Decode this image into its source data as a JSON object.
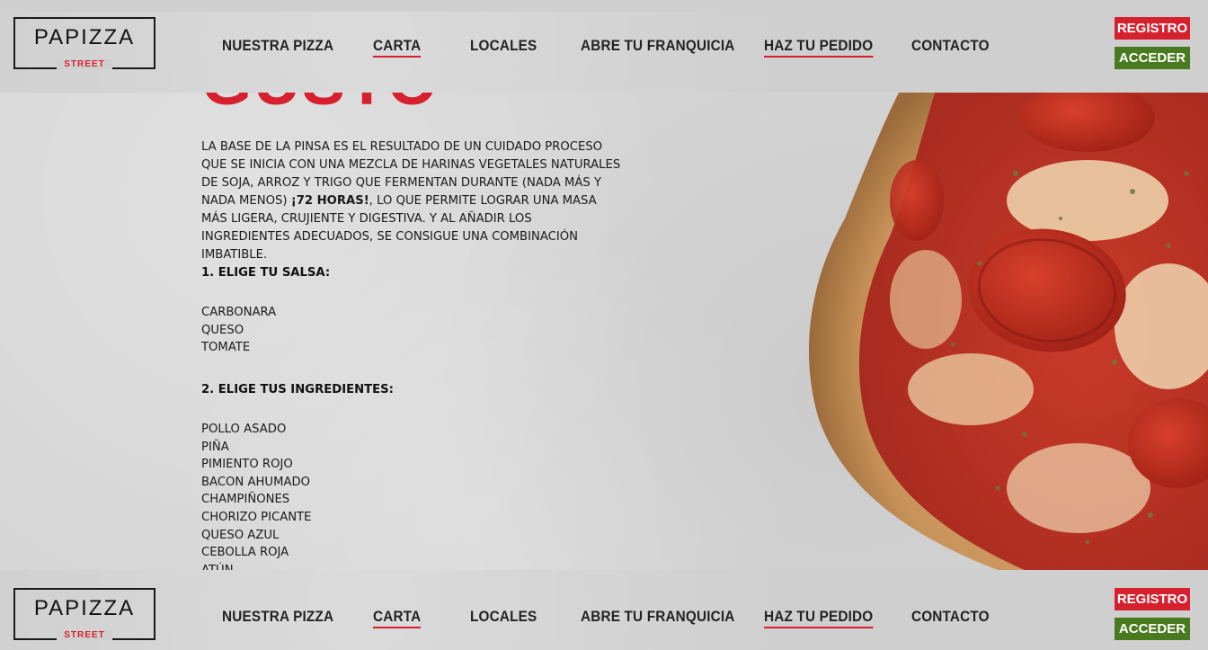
{
  "nav": {
    "logo_main": "PAPIZZA",
    "logo_sub": "STREET",
    "items": [
      {
        "label": "NUESTRA PIZZA"
      },
      {
        "label": "CARTA"
      },
      {
        "label": "LOCALES"
      },
      {
        "label": "ABRE TU FRANQUICIA"
      },
      {
        "label": "HAZ TU PEDIDO"
      },
      {
        "label": "CONTACTO"
      }
    ],
    "registro_label": "REGISTRO",
    "acceder_label": "ACCEDER"
  },
  "main": {
    "heading": "GUSTO",
    "intro_before": "LA BASE DE LA PINSA ES EL RESULTADO DE UN CUIDADO PROCESO QUE SE INICIA CON UNA MEZCLA DE HARINAS VEGETALES NATURALES DE SOJA, ARROZ Y TRIGO QUE FERMENTAN DURANTE (NADA MÁS Y NADA MENOS) ",
    "intro_bold": "¡72 HORAS!",
    "intro_after": ", LO QUE PERMITE LOGRAR UNA MASA MÁS LIGERA, CRUJIENTE Y DIGESTIVA. Y AL AÑADIR LOS INGREDIENTES ADECUADOS, SE CONSIGUE UNA COMBINACIÓN IMBATIBLE.",
    "sauce_title": "1. ELIGE TU SALSA:",
    "sauces": [
      "CARBONARA",
      "QUESO",
      "TOMATE"
    ],
    "ingredients_title": "2. ELIGE TUS INGREDIENTES:",
    "ingredients": [
      "POLLO ASADO",
      "PIÑA",
      "PIMIENTO ROJO",
      "BACON AHUMADO",
      "CHAMPIÑONES",
      "CHORIZO PICANTE",
      "QUESO AZUL",
      "CEBOLLA ROJA",
      "ATÚN"
    ]
  },
  "colors": {
    "brand_red": "#d6202e",
    "brand_green": "#4a7a1f",
    "background": "#d6d6d6"
  }
}
